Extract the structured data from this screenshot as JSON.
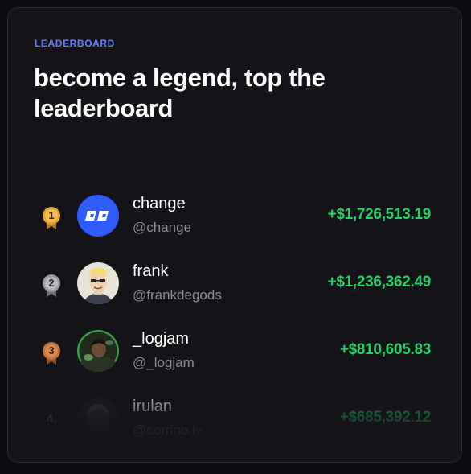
{
  "section_label": "LEADERBOARD",
  "headline": "become a legend, top the leaderboard",
  "colors": {
    "accent": "#6c7cff",
    "positive": "#22d266",
    "gold": "#e3a53a",
    "silver": "#9a9aa0",
    "bronze": "#c0733f",
    "change_brand": "#2f5bff"
  },
  "entries": [
    {
      "rank": "1",
      "name": "change",
      "handle": "@change",
      "amount": "+$1,726,513.19",
      "medal": "gold-medal-icon"
    },
    {
      "rank": "2",
      "name": "frank",
      "handle": "@frankdegods",
      "amount": "+$1,236,362.49",
      "medal": "silver-medal-icon"
    },
    {
      "rank": "3",
      "name": "_logjam",
      "handle": "@_logjam",
      "amount": "+$810,605.83",
      "medal": "bronze-medal-icon"
    },
    {
      "rank": "4.",
      "name": "irulan",
      "handle": "@corrino.iv",
      "amount": "+$685,392.12"
    }
  ]
}
